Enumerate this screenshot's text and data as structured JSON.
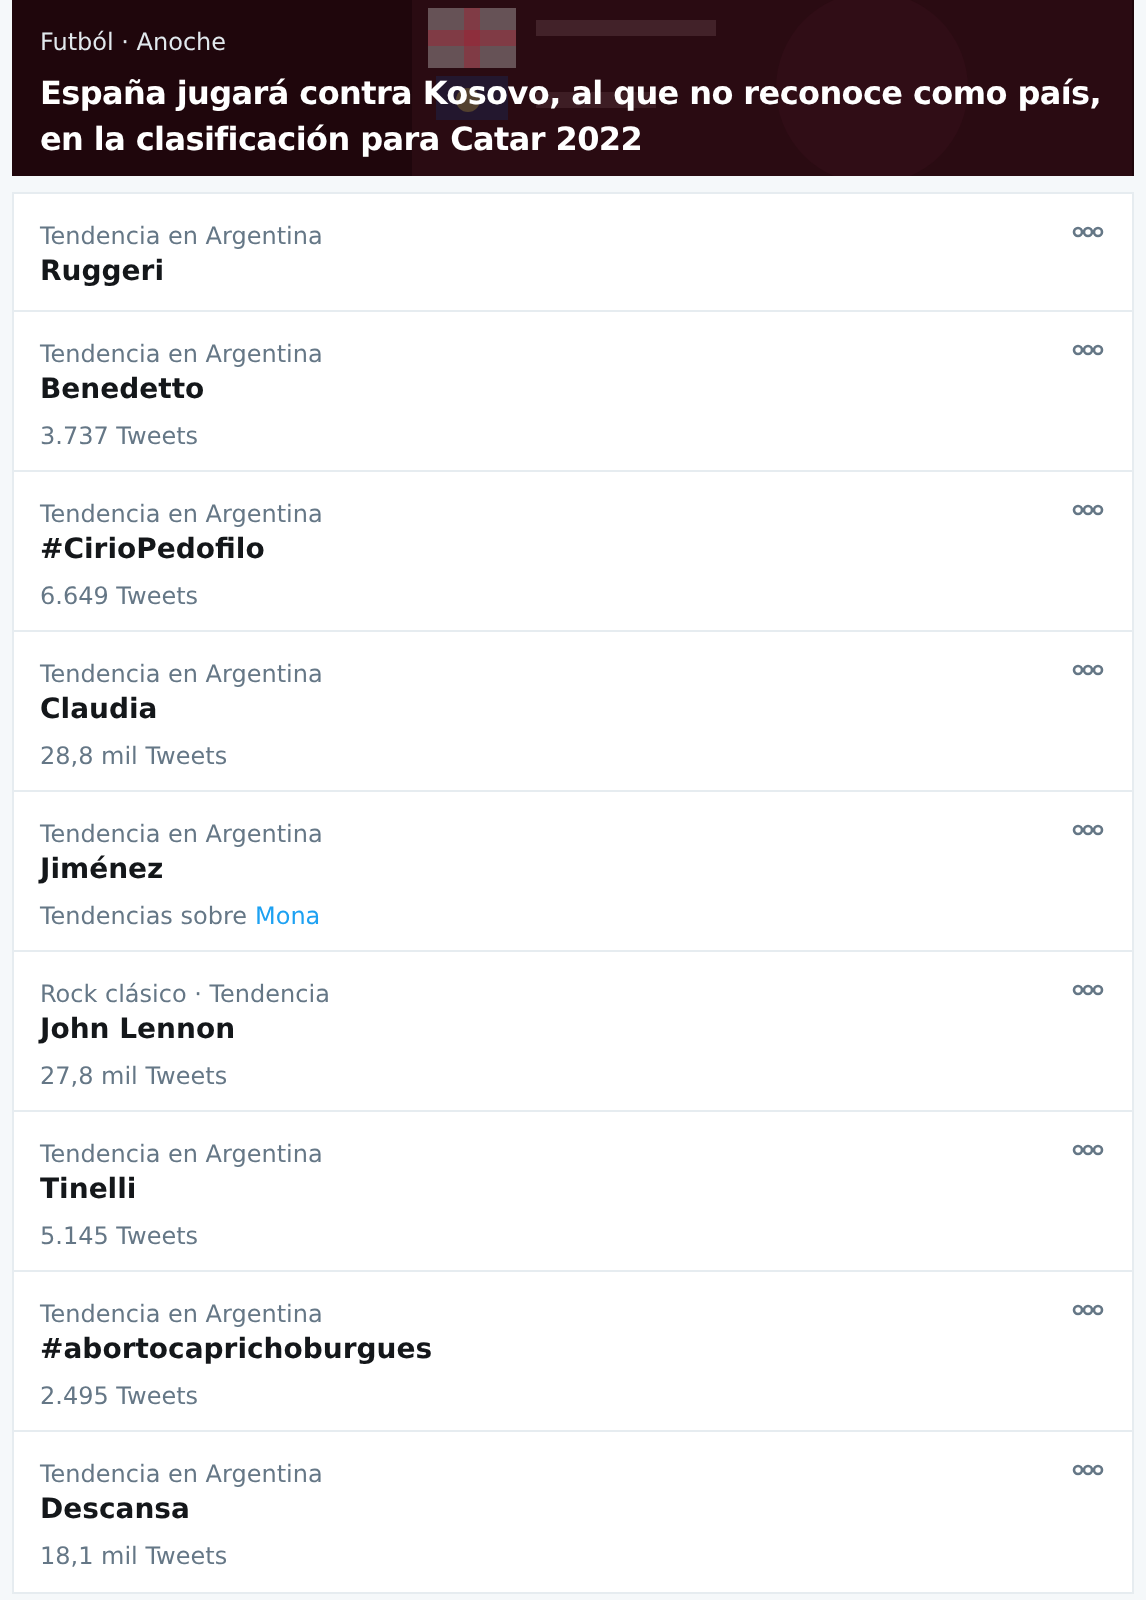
{
  "headline": {
    "kind": "picture",
    "meta": "Futból · Anoche",
    "title": "España jugará contra Kosovo, al que no reconoce como país, en la clasificación para Catar 2022"
  },
  "trends": [
    {
      "meta": "Tendencia en Argentina",
      "name": "Ruggeri"
    },
    {
      "meta": "Tendencia en Argentina",
      "name": "Benedetto",
      "count": "3.737 Tweets"
    },
    {
      "meta": "Tendencia en Argentina",
      "name": "#CirioPedofilo",
      "count": "6.649 Tweets"
    },
    {
      "meta": "Tendencia en Argentina",
      "name": "Claudia",
      "count": "28,8 mil Tweets"
    },
    {
      "meta": "Tendencia en Argentina",
      "name": "Jiménez",
      "related_label": "Tendencias sobre",
      "related_link": "Mona"
    },
    {
      "meta": "Rock clásico · Tendencia",
      "name": "John Lennon",
      "count": "27,8 mil Tweets"
    },
    {
      "meta": "Tendencia en Argentina",
      "name": "Tinelli",
      "count": "5.145 Tweets"
    },
    {
      "meta": "Tendencia en Argentina",
      "name": "#abortocaprichoburgues",
      "count": "2.495 Tweets"
    },
    {
      "meta": "Tendencia en Argentina",
      "name": "Descansa",
      "count": "18,1 mil Tweets"
    }
  ]
}
